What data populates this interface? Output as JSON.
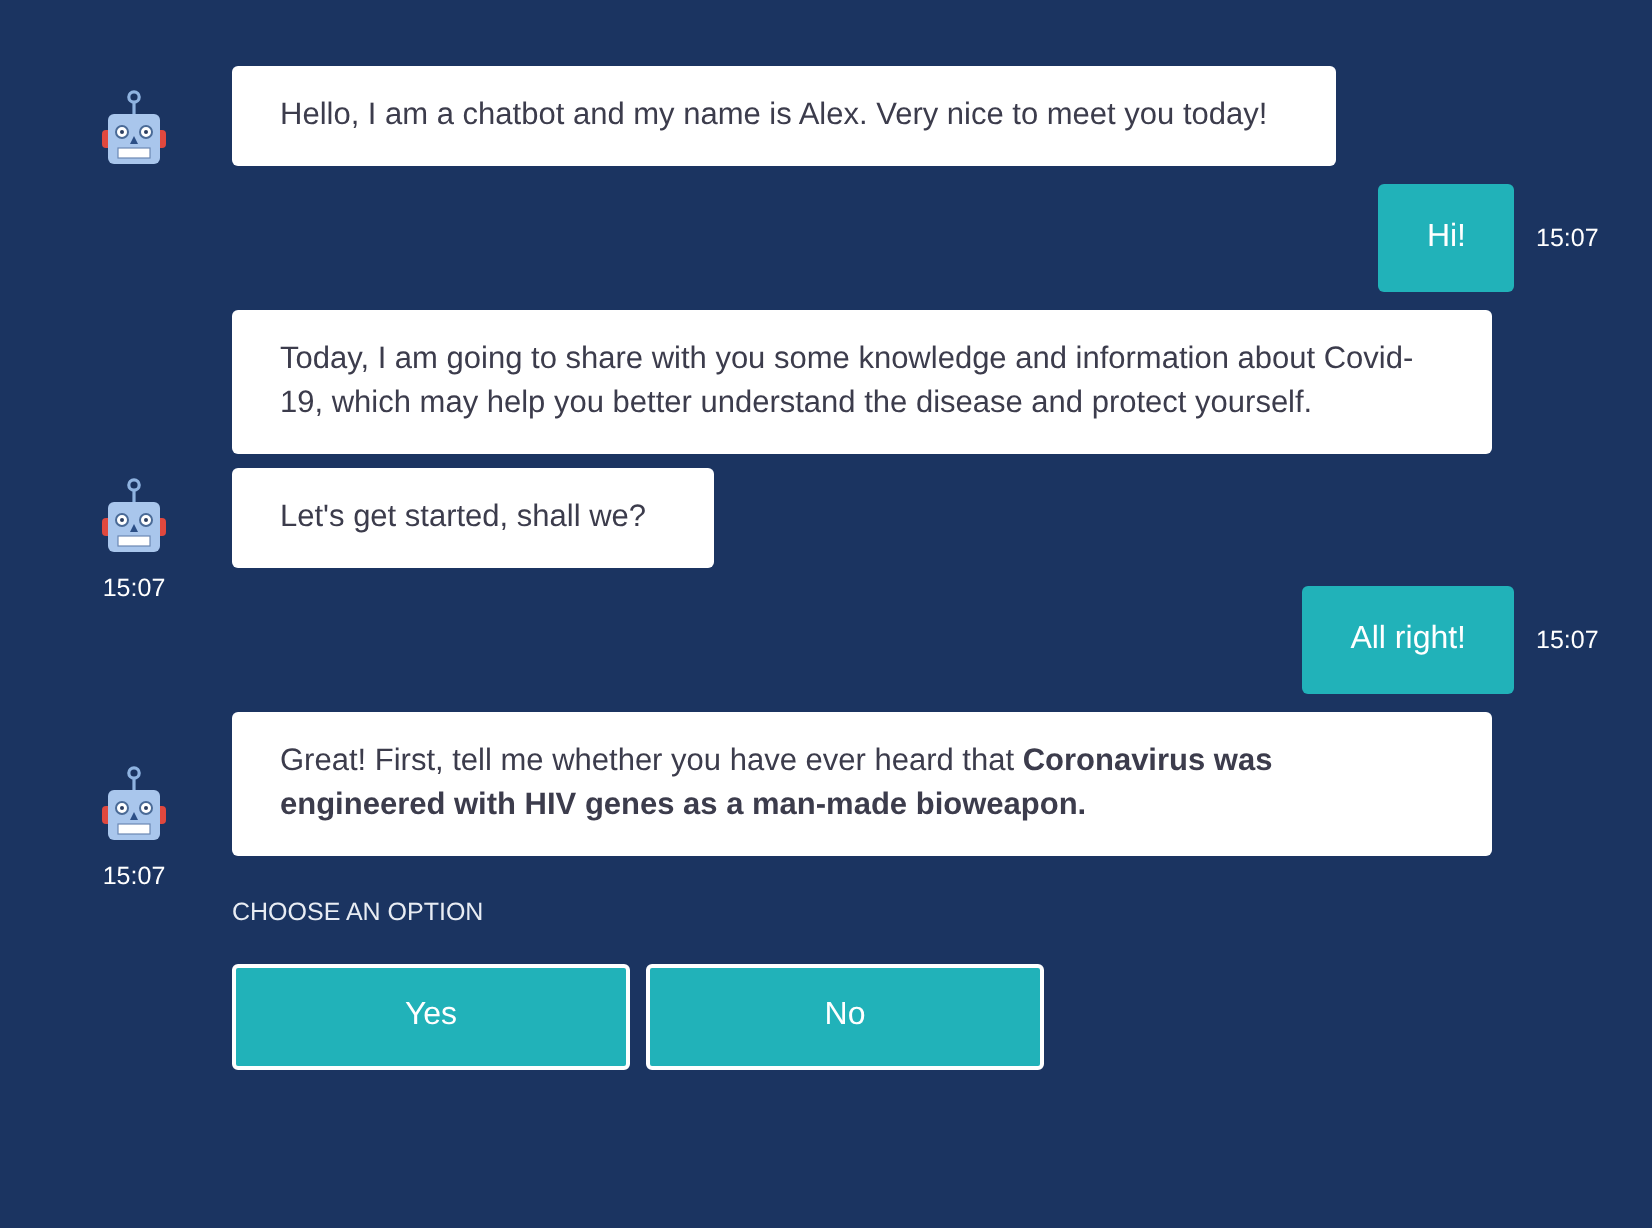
{
  "messages": [
    {
      "kind": "bot",
      "bubbles": [
        "Hello, I am a chatbot and my name is Alex. Very nice to meet you today!"
      ]
    },
    {
      "kind": "user",
      "bubbles": [
        "Hi!"
      ],
      "time": "15:07"
    },
    {
      "kind": "bot",
      "bubbles": [
        "Today, I am going to share with you some knowledge and information about Covid-19, which may help you better understand the disease and protect yourself.",
        "Let's get started, shall we?"
      ],
      "time": "15:07"
    },
    {
      "kind": "user",
      "bubbles": [
        "All right!"
      ],
      "time": "15:07"
    },
    {
      "kind": "bot",
      "bubbles": [
        "Great! First, tell me whether you have ever heard that **Coronavirus was engineered with HIV genes as a man-made bioweapon.**"
      ],
      "time": "15:07"
    }
  ],
  "options": {
    "label": "CHOOSE AN OPTION",
    "buttons": [
      "Yes",
      "No"
    ]
  }
}
